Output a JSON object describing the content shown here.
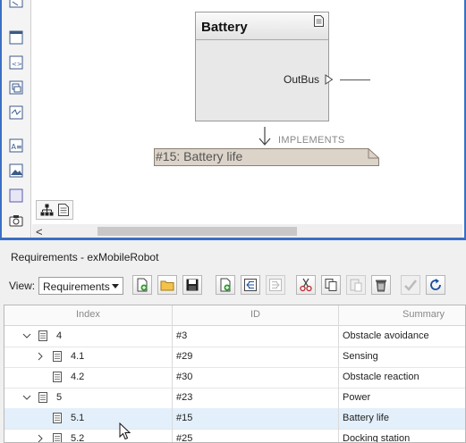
{
  "canvas": {
    "component": {
      "name": "Battery",
      "port": "OutBus"
    },
    "link": {
      "label": "IMPLEMENTS"
    },
    "requirement_note": "#15: Battery life",
    "scroll_left_glyph": "<"
  },
  "requirements_panel": {
    "title": "Requirements - exMobileRobot",
    "view_label": "View:",
    "view_selected": "Requirements",
    "columns": {
      "index": "Index",
      "id": "ID",
      "summary": "Summary"
    },
    "rows": [
      {
        "index": "4",
        "id": "#3",
        "summary": "Obstacle avoidance",
        "expanded": true,
        "level": 0
      },
      {
        "index": "4.1",
        "id": "#29",
        "summary": "Sensing",
        "expanded": false,
        "level": 1
      },
      {
        "index": "4.2",
        "id": "#30",
        "summary": "Obstacle reaction",
        "level": 1
      },
      {
        "index": "5",
        "id": "#23",
        "summary": "Power",
        "expanded": true,
        "level": 0
      },
      {
        "index": "5.1",
        "id": "#15",
        "summary": "Battery life",
        "level": 1,
        "selected": true
      },
      {
        "index": "5.2",
        "id": "#25",
        "summary": "Docking station",
        "expanded": false,
        "level": 1
      }
    ]
  },
  "toolbar_icons": [
    "add-requirement-icon",
    "open-folder-icon",
    "save-icon",
    "add-child-requirement-icon",
    "promote-icon",
    "demote-icon",
    "cut-icon",
    "copy-icon",
    "paste-icon",
    "delete-icon",
    "link-icon",
    "refresh-icon"
  ],
  "colors": {
    "accent": "#3a6fc4",
    "selected_row": "#e3f0fb",
    "note_fill": "#dcd3c9"
  }
}
